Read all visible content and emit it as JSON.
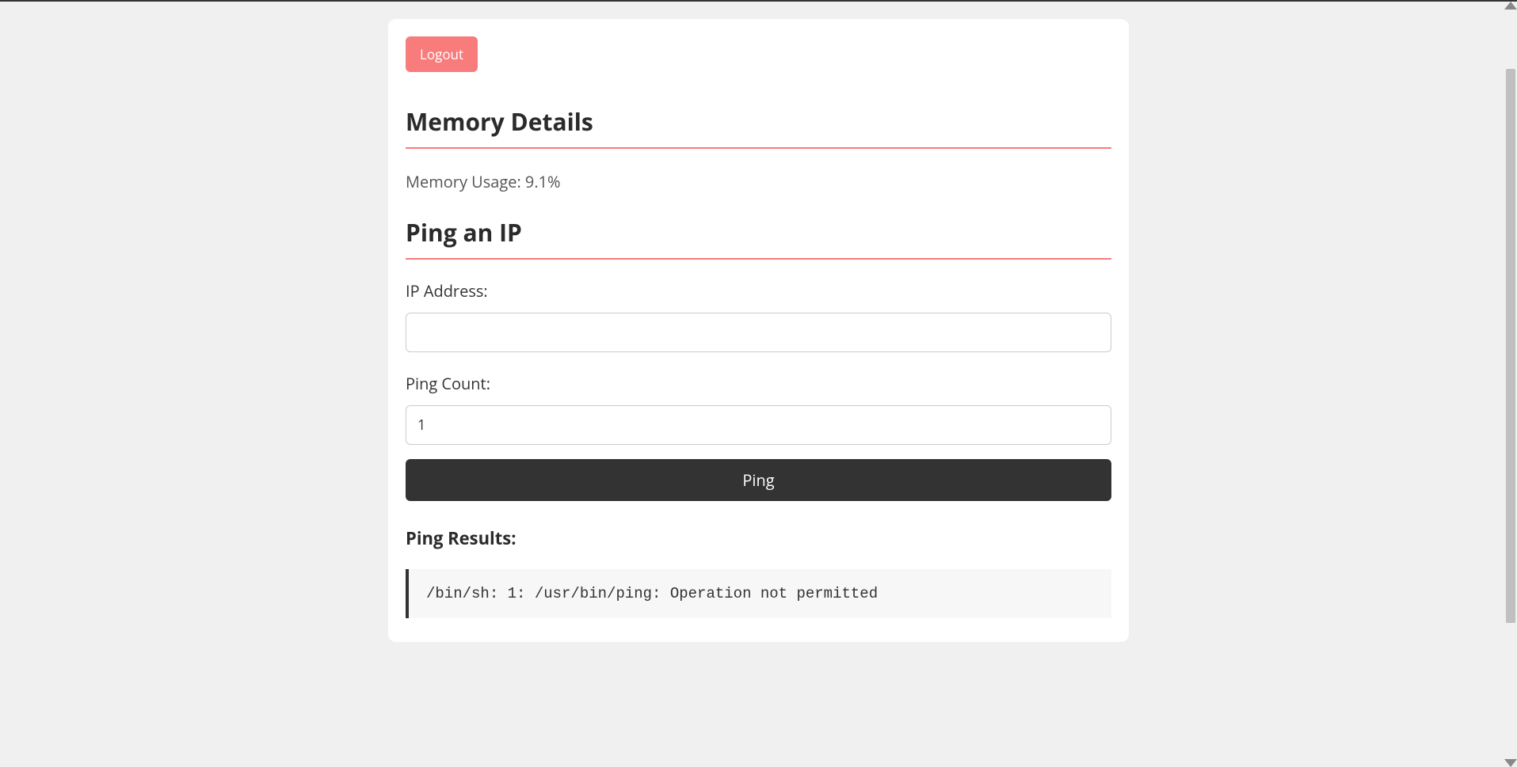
{
  "logout_label": "Logout",
  "sections": {
    "memory": {
      "title": "Memory Details",
      "usage_text": "Memory Usage: 9.1%"
    },
    "ping": {
      "title": "Ping an IP",
      "ip_label": "IP Address:",
      "ip_value": "",
      "count_label": "Ping Count:",
      "count_value": "1",
      "button_label": "Ping"
    },
    "results": {
      "title": "Ping Results:",
      "output": "/bin/sh: 1: /usr/bin/ping: Operation not permitted"
    }
  }
}
